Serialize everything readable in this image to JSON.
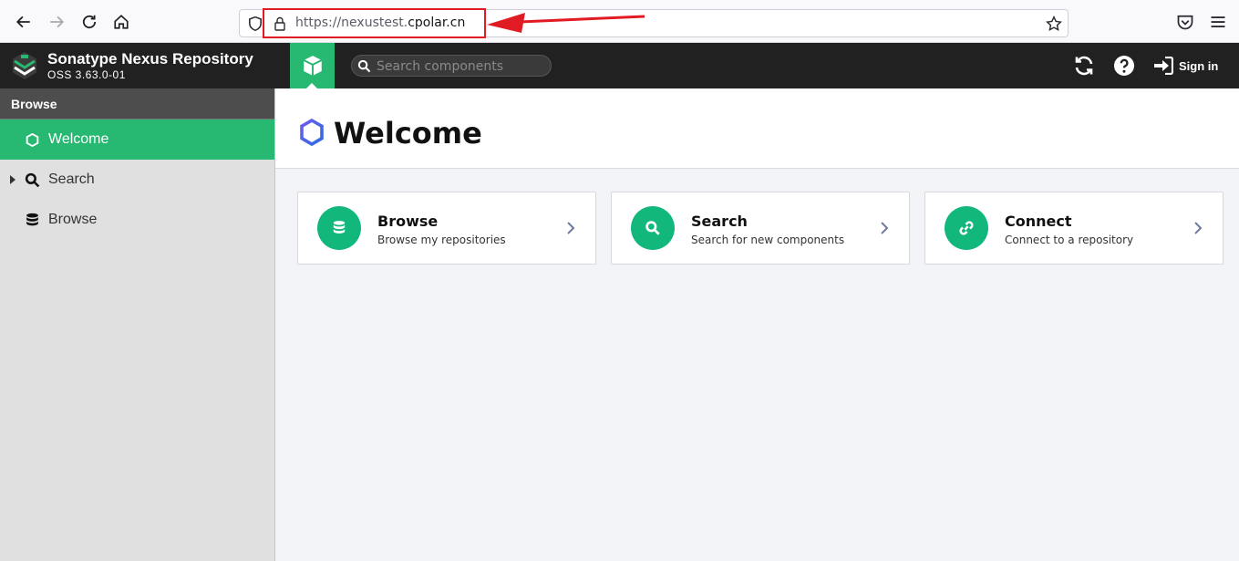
{
  "browser": {
    "url_prefix": "https://nexustest.",
    "url_host": "cpolar.cn",
    "icons": [
      "back-icon",
      "forward-icon",
      "reload-icon",
      "home-icon",
      "shield-icon",
      "lock-icon",
      "star-icon",
      "pocket-icon",
      "menu-icon"
    ],
    "annotation_color": "#e01b24"
  },
  "header": {
    "title": "Sonatype Nexus Repository",
    "version": "OSS 3.63.0-01",
    "search_placeholder": "Search components",
    "signin_label": "Sign in",
    "accent": "#27b871",
    "background": "#212121"
  },
  "sidebar": {
    "section_title": "Browse",
    "items": [
      {
        "label": "Welcome",
        "icon": "hexagon-icon",
        "active": true
      },
      {
        "label": "Search",
        "icon": "search-icon",
        "active": false,
        "expandable": true
      },
      {
        "label": "Browse",
        "icon": "database-icon",
        "active": false
      }
    ]
  },
  "main": {
    "title": "Welcome",
    "cards": [
      {
        "title": "Browse",
        "subtitle": "Browse my repositories",
        "icon": "database-icon"
      },
      {
        "title": "Search",
        "subtitle": "Search for new components",
        "icon": "search-icon"
      },
      {
        "title": "Connect",
        "subtitle": "Connect to a repository",
        "icon": "link-icon"
      }
    ],
    "card_icon_color": "#12b87b"
  }
}
